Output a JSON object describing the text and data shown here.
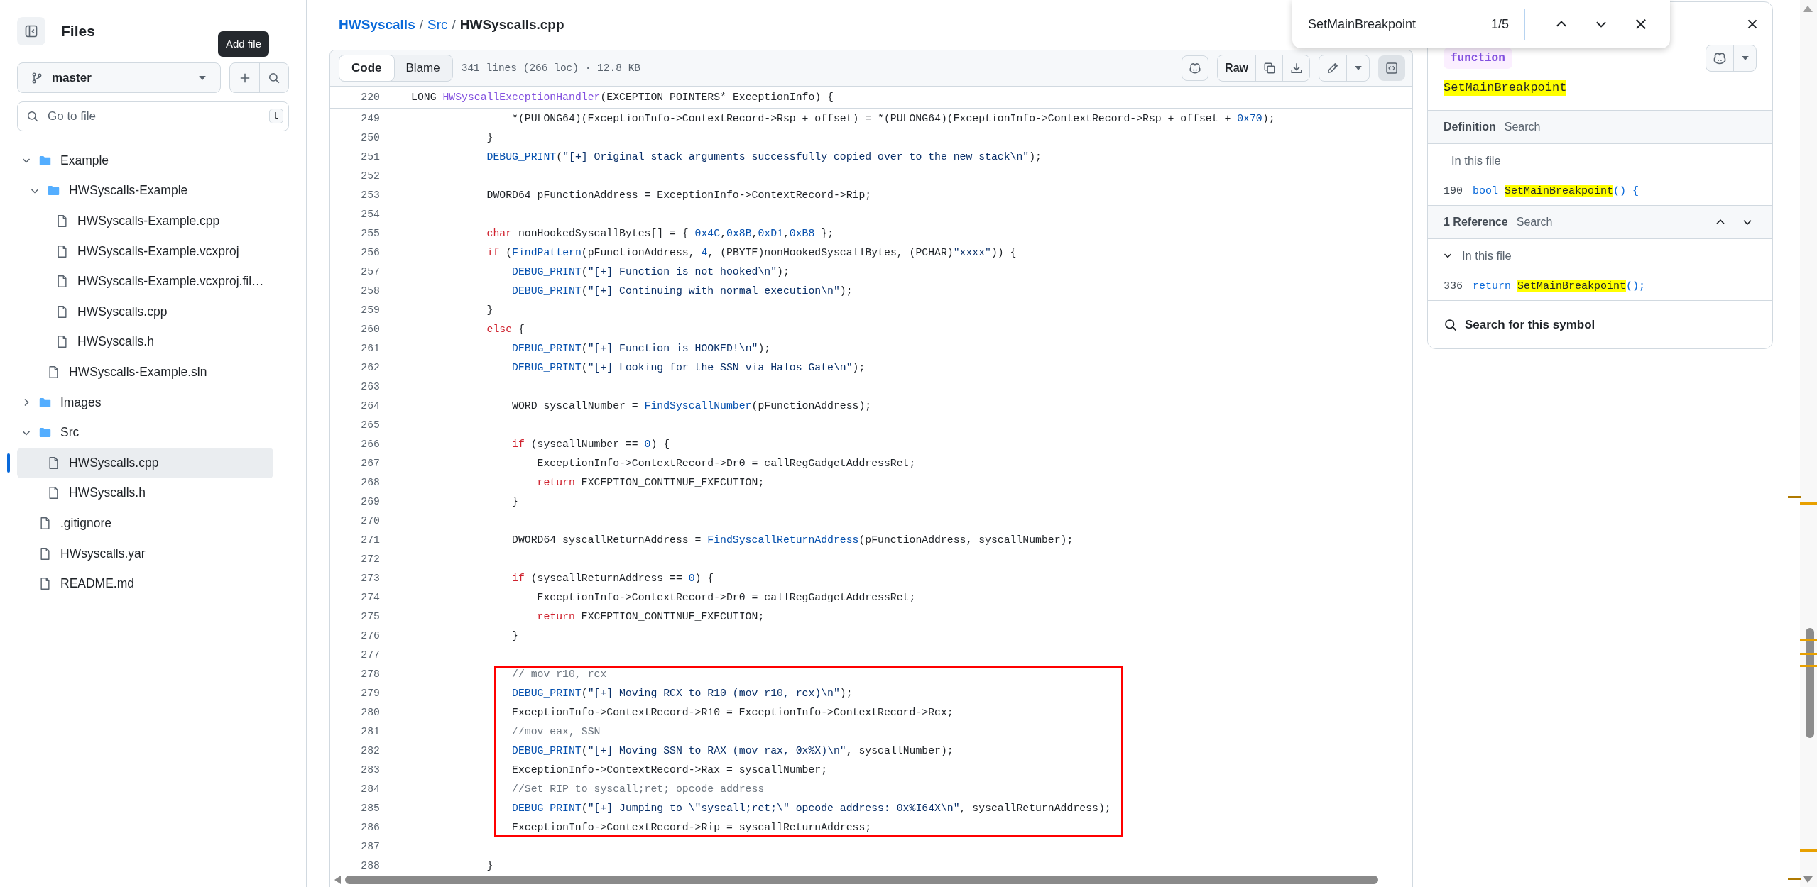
{
  "sidebar": {
    "title": "Files",
    "tooltip": "Add file",
    "branch": "master",
    "search": {
      "placeholder": "Go to file",
      "shortcut": "t"
    },
    "tree": [
      {
        "kind": "folder",
        "label": "Example",
        "expanded": true,
        "selected": false,
        "children": [
          {
            "kind": "folder",
            "label": "HWSyscalls-Example",
            "expanded": true,
            "selected": false,
            "children": [
              {
                "kind": "file",
                "label": "HWSyscalls-Example.cpp",
                "selected": false
              },
              {
                "kind": "file",
                "label": "HWSyscalls-Example.vcxproj",
                "selected": false
              },
              {
                "kind": "file",
                "label": "HWSyscalls-Example.vcxproj.fil…",
                "selected": false
              },
              {
                "kind": "file",
                "label": "HWSyscalls.cpp",
                "selected": false
              },
              {
                "kind": "file",
                "label": "HWSyscalls.h",
                "selected": false
              }
            ]
          },
          {
            "kind": "file",
            "label": "HWSyscalls-Example.sln",
            "selected": false
          }
        ]
      },
      {
        "kind": "folder",
        "label": "Images",
        "expanded": false,
        "selected": false
      },
      {
        "kind": "folder",
        "label": "Src",
        "expanded": true,
        "selected": false,
        "children": [
          {
            "kind": "file",
            "label": "HWSyscalls.cpp",
            "selected": true
          },
          {
            "kind": "file",
            "label": "HWSyscalls.h",
            "selected": false
          }
        ]
      },
      {
        "kind": "file",
        "label": ".gitignore",
        "selected": false
      },
      {
        "kind": "file",
        "label": "HWsyscalls.yar",
        "selected": false
      },
      {
        "kind": "file",
        "label": "README.md",
        "selected": false
      }
    ]
  },
  "breadcrumb": [
    {
      "kind": "repo",
      "label": "HWSyscalls"
    },
    {
      "kind": "separator",
      "label": "/"
    },
    {
      "kind": "link",
      "label": "Src"
    },
    {
      "kind": "separator",
      "label": "/"
    },
    {
      "kind": "current",
      "label": "HWSyscalls.cpp"
    }
  ],
  "toolbar": {
    "view_tabs": [
      {
        "label": "Code",
        "selected": true
      },
      {
        "label": "Blame",
        "selected": false
      }
    ],
    "file_info": "341 lines (266 loc) · 12.8 KB",
    "raw_button": "Raw",
    "symbols_toggle": {
      "on": true
    }
  },
  "code": {
    "sticky_line": {
      "number": "220",
      "tokens": [
        {
          "kind": "plain",
          "text": "LONG "
        },
        {
          "kind": "entity",
          "text": "HWSyscallExceptionHandler"
        },
        {
          "kind": "plain",
          "text": "(EXCEPTION_POINTERS* ExceptionInfo) {"
        }
      ]
    },
    "lines": [
      {
        "number": "249",
        "annotated": false,
        "tokens": [
          {
            "kind": "plain",
            "text": "                *(PULONG64)(ExceptionInfo->ContextRecord->Rsp + offset) = *(PULONG64)(ExceptionInfo->ContextRecord->Rsp + offset + "
          },
          {
            "kind": "number",
            "text": "0x70"
          },
          {
            "kind": "plain",
            "text": ");"
          }
        ]
      },
      {
        "number": "250",
        "annotated": false,
        "tokens": [
          {
            "kind": "plain",
            "text": "            }"
          }
        ]
      },
      {
        "number": "251",
        "annotated": false,
        "tokens": [
          {
            "kind": "call",
            "text": "            DEBUG_PRINT"
          },
          {
            "kind": "plain",
            "text": "("
          },
          {
            "kind": "string",
            "text": "\"[+] Original stack arguments successfully copied over to the new stack\\n\""
          },
          {
            "kind": "plain",
            "text": ");"
          }
        ]
      },
      {
        "number": "252",
        "annotated": false
      },
      {
        "number": "253",
        "annotated": false,
        "tokens": [
          {
            "kind": "plain",
            "text": "            DWORD64 pFunctionAddress = ExceptionInfo->ContextRecord->Rip;"
          }
        ]
      },
      {
        "number": "254",
        "annotated": false
      },
      {
        "number": "255",
        "annotated": false,
        "tokens": [
          {
            "kind": "keyword",
            "text": "            char"
          },
          {
            "kind": "plain",
            "text": " nonHookedSyscallBytes[] = { "
          },
          {
            "kind": "number",
            "text": "0x4C"
          },
          {
            "kind": "plain",
            "text": ","
          },
          {
            "kind": "number",
            "text": "0x8B"
          },
          {
            "kind": "plain",
            "text": ","
          },
          {
            "kind": "number",
            "text": "0xD1"
          },
          {
            "kind": "plain",
            "text": ","
          },
          {
            "kind": "number",
            "text": "0xB8"
          },
          {
            "kind": "plain",
            "text": " };"
          }
        ]
      },
      {
        "number": "256",
        "annotated": false,
        "tokens": [
          {
            "kind": "keyword",
            "text": "            if"
          },
          {
            "kind": "plain",
            "text": " ("
          },
          {
            "kind": "call",
            "text": "FindPattern"
          },
          {
            "kind": "plain",
            "text": "(pFunctionAddress, "
          },
          {
            "kind": "number",
            "text": "4"
          },
          {
            "kind": "plain",
            "text": ", (PBYTE)nonHookedSyscallBytes, (PCHAR)"
          },
          {
            "kind": "string",
            "text": "\"xxxx\""
          },
          {
            "kind": "plain",
            "text": ")) {"
          }
        ]
      },
      {
        "number": "257",
        "annotated": false,
        "tokens": [
          {
            "kind": "call",
            "text": "                DEBUG_PRINT"
          },
          {
            "kind": "plain",
            "text": "("
          },
          {
            "kind": "string",
            "text": "\"[+] Function is not hooked\\n\""
          },
          {
            "kind": "plain",
            "text": ");"
          }
        ]
      },
      {
        "number": "258",
        "annotated": false,
        "tokens": [
          {
            "kind": "call",
            "text": "                DEBUG_PRINT"
          },
          {
            "kind": "plain",
            "text": "("
          },
          {
            "kind": "string",
            "text": "\"[+] Continuing with normal execution\\n\""
          },
          {
            "kind": "plain",
            "text": ");"
          }
        ]
      },
      {
        "number": "259",
        "annotated": false,
        "tokens": [
          {
            "kind": "plain",
            "text": "            }"
          }
        ]
      },
      {
        "number": "260",
        "annotated": false,
        "tokens": [
          {
            "kind": "keyword",
            "text": "            else"
          },
          {
            "kind": "plain",
            "text": " {"
          }
        ]
      },
      {
        "number": "261",
        "annotated": false,
        "tokens": [
          {
            "kind": "call",
            "text": "                DEBUG_PRINT"
          },
          {
            "kind": "plain",
            "text": "("
          },
          {
            "kind": "string",
            "text": "\"[+] Function is HOOKED!\\n\""
          },
          {
            "kind": "plain",
            "text": ");"
          }
        ]
      },
      {
        "number": "262",
        "annotated": false,
        "tokens": [
          {
            "kind": "call",
            "text": "                DEBUG_PRINT"
          },
          {
            "kind": "plain",
            "text": "("
          },
          {
            "kind": "string",
            "text": "\"[+] Looking for the SSN via Halos Gate\\n\""
          },
          {
            "kind": "plain",
            "text": ");"
          }
        ]
      },
      {
        "number": "263",
        "annotated": false
      },
      {
        "number": "264",
        "annotated": false,
        "tokens": [
          {
            "kind": "plain",
            "text": "                WORD syscallNumber = "
          },
          {
            "kind": "call",
            "text": "FindSyscallNumber"
          },
          {
            "kind": "plain",
            "text": "(pFunctionAddress);"
          }
        ]
      },
      {
        "number": "265",
        "annotated": false
      },
      {
        "number": "266",
        "annotated": false,
        "tokens": [
          {
            "kind": "keyword",
            "text": "                if"
          },
          {
            "kind": "plain",
            "text": " (syscallNumber == "
          },
          {
            "kind": "number",
            "text": "0"
          },
          {
            "kind": "plain",
            "text": ") {"
          }
        ]
      },
      {
        "number": "267",
        "annotated": false,
        "tokens": [
          {
            "kind": "plain",
            "text": "                    ExceptionInfo->ContextRecord->Dr0 = callRegGadgetAddressRet;"
          }
        ]
      },
      {
        "number": "268",
        "annotated": false,
        "tokens": [
          {
            "kind": "keyword",
            "text": "                    return"
          },
          {
            "kind": "plain",
            "text": " EXCEPTION_CONTINUE_EXECUTION;"
          }
        ]
      },
      {
        "number": "269",
        "annotated": false,
        "tokens": [
          {
            "kind": "plain",
            "text": "                }"
          }
        ]
      },
      {
        "number": "270",
        "annotated": false
      },
      {
        "number": "271",
        "annotated": false,
        "tokens": [
          {
            "kind": "plain",
            "text": "                DWORD64 syscallReturnAddress = "
          },
          {
            "kind": "call",
            "text": "FindSyscallReturnAddress"
          },
          {
            "kind": "plain",
            "text": "(pFunctionAddress, syscallNumber);"
          }
        ]
      },
      {
        "number": "272",
        "annotated": false
      },
      {
        "number": "273",
        "annotated": false,
        "tokens": [
          {
            "kind": "keyword",
            "text": "                if"
          },
          {
            "kind": "plain",
            "text": " (syscallReturnAddress == "
          },
          {
            "kind": "number",
            "text": "0"
          },
          {
            "kind": "plain",
            "text": ") {"
          }
        ]
      },
      {
        "number": "274",
        "annotated": false,
        "tokens": [
          {
            "kind": "plain",
            "text": "                    ExceptionInfo->ContextRecord->Dr0 = callRegGadgetAddressRet;"
          }
        ]
      },
      {
        "number": "275",
        "annotated": false,
        "tokens": [
          {
            "kind": "keyword",
            "text": "                    return"
          },
          {
            "kind": "plain",
            "text": " EXCEPTION_CONTINUE_EXECUTION;"
          }
        ]
      },
      {
        "number": "276",
        "annotated": false,
        "tokens": [
          {
            "kind": "plain",
            "text": "                }"
          }
        ]
      },
      {
        "number": "277",
        "annotated": false
      },
      {
        "number": "278",
        "annotated": true,
        "tokens": [
          {
            "kind": "comment",
            "text": "                // mov r10, rcx"
          }
        ]
      },
      {
        "number": "279",
        "annotated": true,
        "tokens": [
          {
            "kind": "call",
            "text": "                DEBUG_PRINT"
          },
          {
            "kind": "plain",
            "text": "("
          },
          {
            "kind": "string",
            "text": "\"[+] Moving RCX to R10 (mov r10, rcx)\\n\""
          },
          {
            "kind": "plain",
            "text": ");"
          }
        ]
      },
      {
        "number": "280",
        "annotated": true,
        "tokens": [
          {
            "kind": "plain",
            "text": "                ExceptionInfo->ContextRecord->R10 = ExceptionInfo->ContextRecord->Rcx;"
          }
        ]
      },
      {
        "number": "281",
        "annotated": true,
        "tokens": [
          {
            "kind": "comment",
            "text": "                //mov eax, SSN"
          }
        ]
      },
      {
        "number": "282",
        "annotated": true,
        "tokens": [
          {
            "kind": "call",
            "text": "                DEBUG_PRINT"
          },
          {
            "kind": "plain",
            "text": "("
          },
          {
            "kind": "string",
            "text": "\"[+] Moving SSN to RAX (mov rax, 0x%X)\\n\""
          },
          {
            "kind": "plain",
            "text": ", syscallNumber);"
          }
        ]
      },
      {
        "number": "283",
        "annotated": true,
        "tokens": [
          {
            "kind": "plain",
            "text": "                ExceptionInfo->ContextRecord->Rax = syscallNumber;"
          }
        ]
      },
      {
        "number": "284",
        "annotated": true,
        "tokens": [
          {
            "kind": "comment",
            "text": "                //Set RIP to syscall;ret; opcode address"
          }
        ]
      },
      {
        "number": "285",
        "annotated": true,
        "tokens": [
          {
            "kind": "call",
            "text": "                DEBUG_PRINT"
          },
          {
            "kind": "plain",
            "text": "("
          },
          {
            "kind": "string",
            "text": "\"[+] Jumping to \\\"syscall;ret;\\\" opcode address: 0x%I64X\\n\""
          },
          {
            "kind": "plain",
            "text": ", syscallReturnAddress);"
          }
        ]
      },
      {
        "number": "286",
        "annotated": true,
        "tokens": [
          {
            "kind": "plain",
            "text": "                ExceptionInfo->ContextRecord->Rip = syscallReturnAddress;"
          }
        ]
      },
      {
        "number": "287",
        "annotated": false
      },
      {
        "number": "288",
        "annotated": false,
        "tokens": [
          {
            "kind": "plain",
            "text": "            }"
          }
        ]
      }
    ]
  },
  "find_bar": {
    "query": "SetMainBreakpoint",
    "count": "1/5"
  },
  "symbol_panel": {
    "tag": "function",
    "symbol": "SetMainBreakpoint",
    "symbol_highlighted": true,
    "sections": [
      {
        "kind": "definition",
        "title": "Definition",
        "search_link": "Search",
        "scope": "In this file",
        "entries": [
          {
            "line": "190",
            "tokens": [
              {
                "kind": "type",
                "text": "bool "
              },
              {
                "kind": "match",
                "text": "SetMainBreakpoint"
              },
              {
                "kind": "type",
                "text": "() {"
              }
            ]
          }
        ]
      },
      {
        "kind": "references",
        "title": "1 Reference",
        "search_link": "Search",
        "scope": "In this file",
        "scope_expanded": true,
        "entries": [
          {
            "line": "336",
            "tokens": [
              {
                "kind": "type",
                "text": "return "
              },
              {
                "kind": "match",
                "text": "SetMainBreakpoint"
              },
              {
                "kind": "type",
                "text": "();"
              }
            ]
          }
        ]
      }
    ],
    "footer": "Search for this symbol"
  }
}
